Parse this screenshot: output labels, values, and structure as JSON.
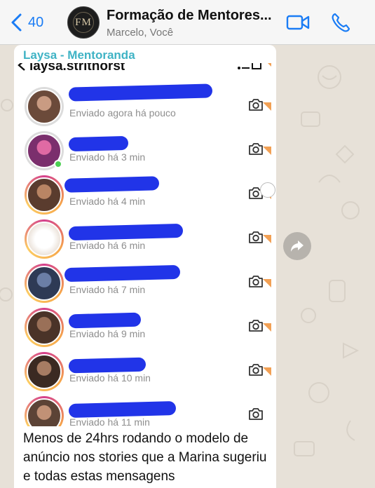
{
  "header": {
    "back_count": "40",
    "group_avatar_text": "FM",
    "title": "Formação de Mentores...",
    "subtitle": "Marcelo, Você"
  },
  "message": {
    "sender": "Laysa - Mentoranda",
    "screenshot": {
      "username": "laysa.strithorst",
      "rows": [
        {
          "status": "Enviado agora há pouco",
          "avatar": "photo",
          "ring": "none",
          "online": false
        },
        {
          "status": "Enviado há 3 min",
          "avatar": "photo",
          "ring": "none",
          "online": true
        },
        {
          "status": "Enviado há 4 min",
          "avatar": "photo",
          "ring": "story",
          "online": false
        },
        {
          "status": "Enviado há 6 min",
          "avatar": "logo",
          "ring": "story",
          "online": false
        },
        {
          "status": "Enviado há 7 min",
          "avatar": "photo",
          "ring": "story",
          "online": false
        },
        {
          "status": "Enviado há 9 min",
          "avatar": "photo",
          "ring": "story",
          "online": false
        },
        {
          "status": "Enviado há 10 min",
          "avatar": "photo",
          "ring": "story",
          "online": false
        },
        {
          "status": "Enviado há 11 min",
          "avatar": "photo",
          "ring": "story",
          "online": false
        }
      ]
    },
    "caption": "Menos de 24hrs rodando o modelo de anúncio nos stories que a Marina sugeriu e todas estas mensagens"
  },
  "colors": {
    "ios_blue": "#1a7cf5",
    "sender_name": "#3fb3c5",
    "redaction": "#2134e8",
    "story_ring_start": "#d43f8d",
    "story_ring_end": "#fccc63"
  },
  "icons": [
    "chevron-left-icon",
    "video-call-icon",
    "phone-icon",
    "camera-icon",
    "forward-icon"
  ]
}
